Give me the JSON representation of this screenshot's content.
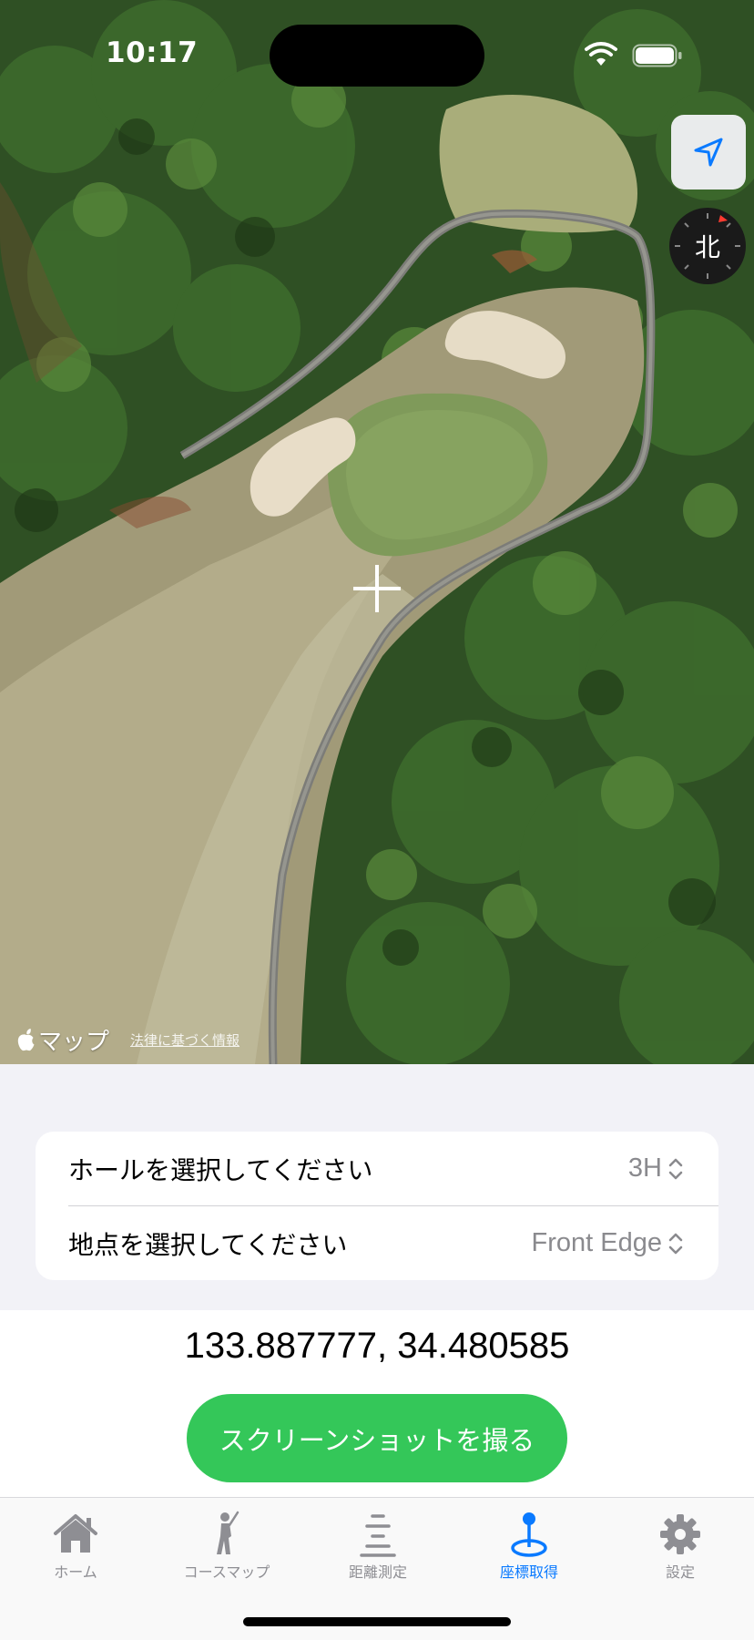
{
  "status_bar": {
    "time": "10:17"
  },
  "map": {
    "attribution": "マップ",
    "legal_link": "法律に基づく情報",
    "compass_label": "北"
  },
  "selectors": {
    "hole": {
      "label": "ホールを選択してください",
      "value": "3H"
    },
    "point": {
      "label": "地点を選択してください",
      "value": "Front Edge"
    }
  },
  "coordinates": "133.887777, 34.480585",
  "screenshot_button": "スクリーンショットを撮る",
  "tabs": [
    {
      "label": "ホーム",
      "icon": "house-icon",
      "active": false
    },
    {
      "label": "コースマップ",
      "icon": "golfer-icon",
      "active": false
    },
    {
      "label": "距離測定",
      "icon": "distance-lines-icon",
      "active": false
    },
    {
      "label": "座標取得",
      "icon": "location-pin-icon",
      "active": true
    },
    {
      "label": "設定",
      "icon": "gear-icon",
      "active": false
    }
  ],
  "colors": {
    "accent": "#0a7aff",
    "button_green": "#34c759",
    "inactive_tab": "#8e8e93"
  }
}
